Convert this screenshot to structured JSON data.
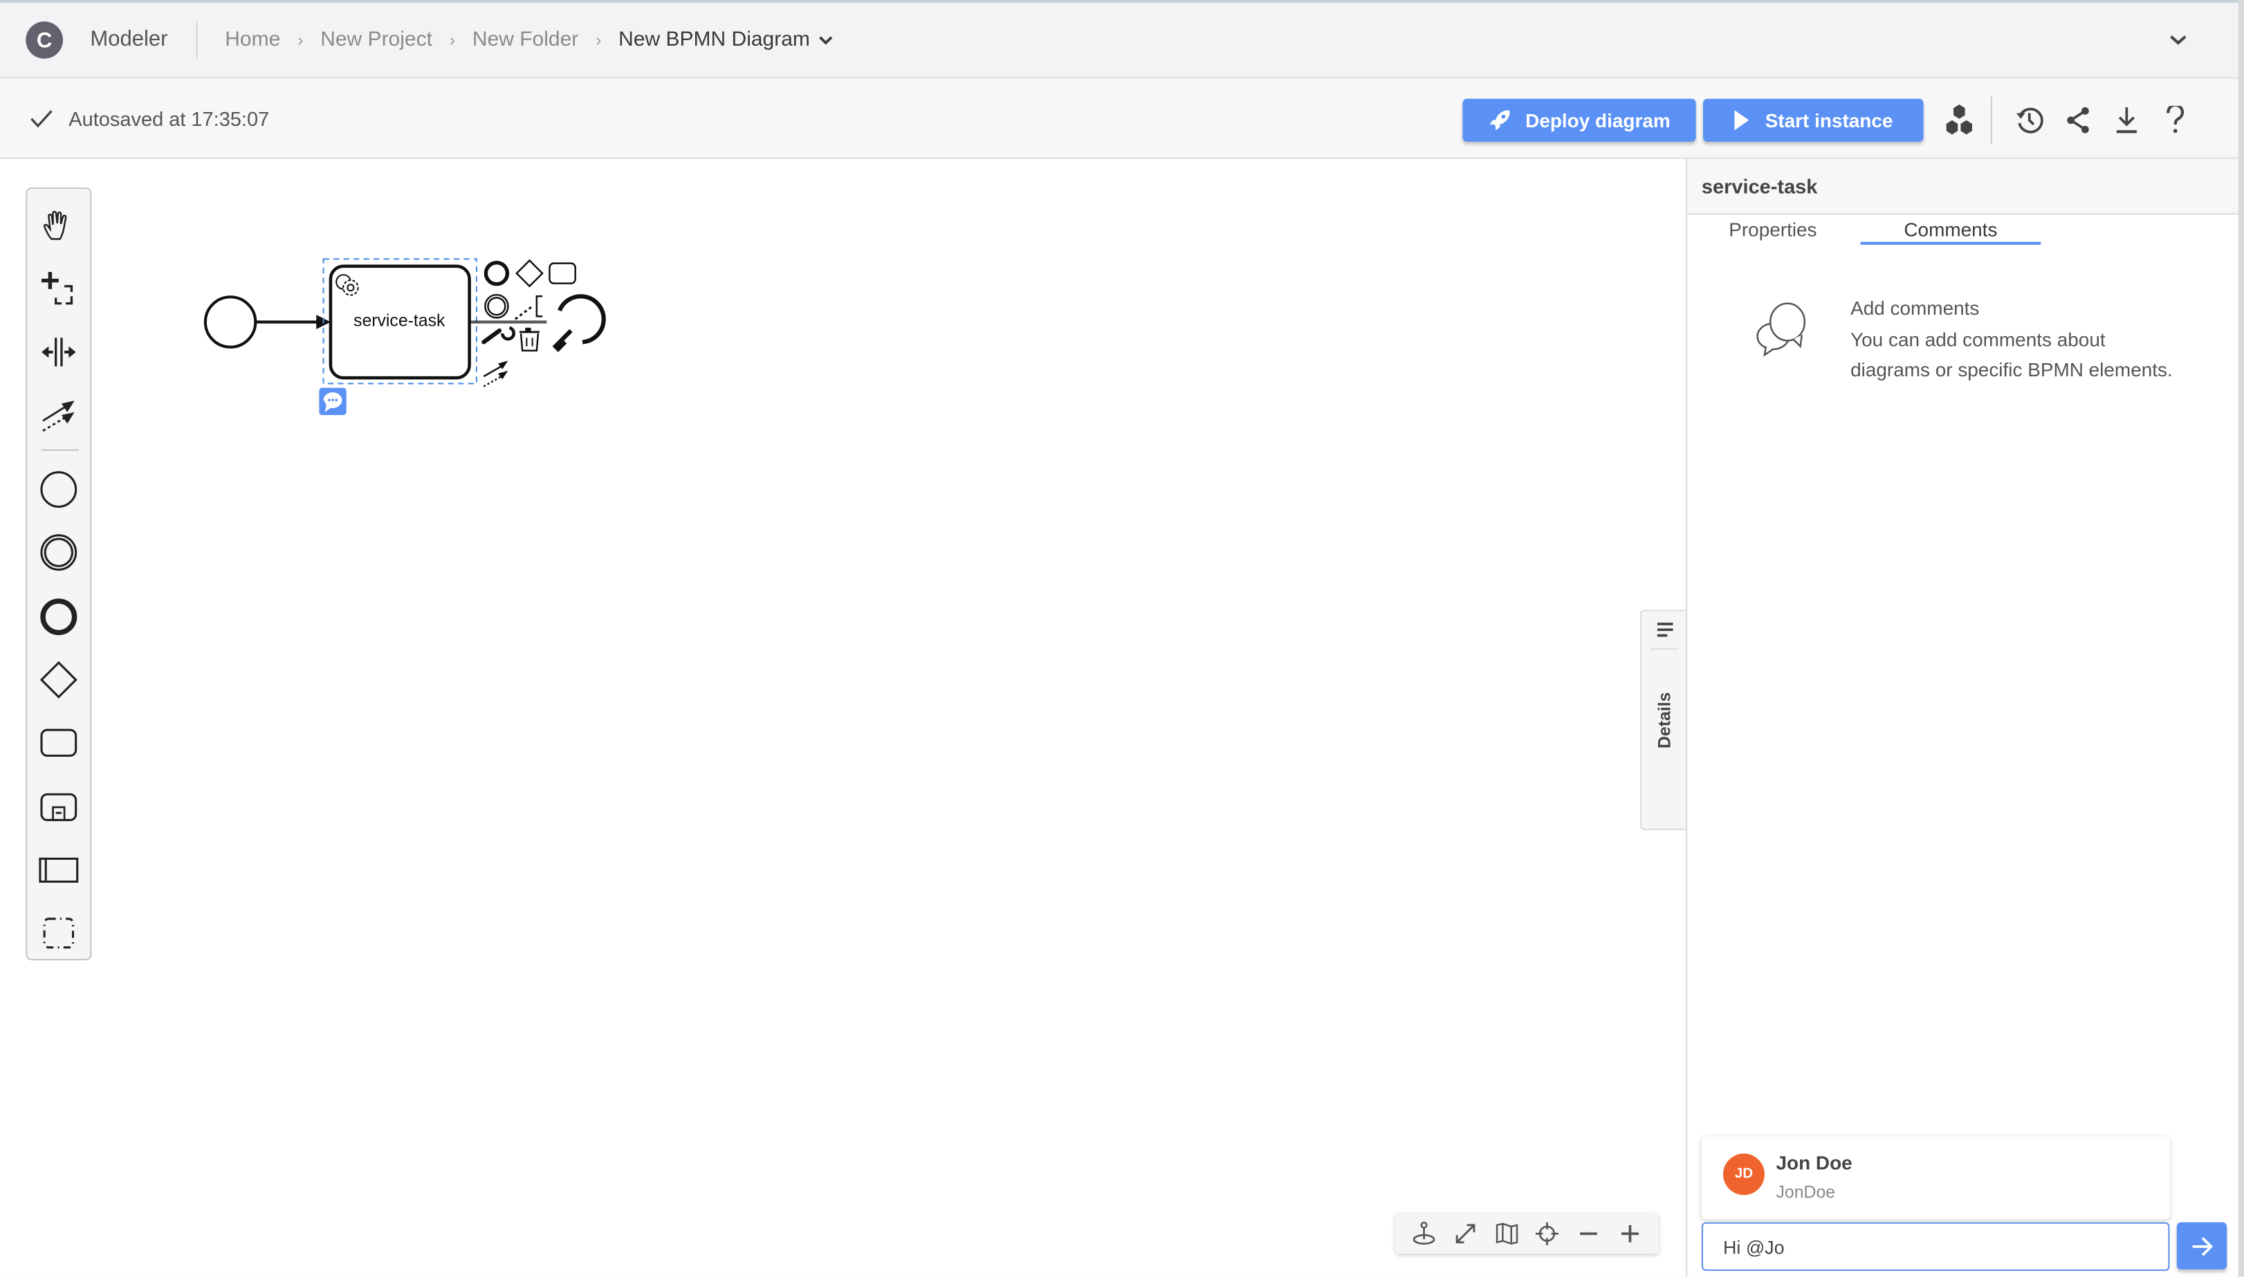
{
  "topbar": {
    "logo_letter": "C",
    "app_name": "Modeler",
    "breadcrumbs": [
      "Home",
      "New Project",
      "New Folder"
    ],
    "current_diagram": "New BPMN Diagram",
    "breadcrumb_separator": "›"
  },
  "subbar": {
    "status_icon": "check-icon",
    "autosave_text": "Autosaved at 17:35:07",
    "deploy_label": "Deploy diagram",
    "start_label": "Start instance",
    "icons": [
      "cluster-icon",
      "history-icon",
      "share-icon",
      "download-icon",
      "help-icon"
    ]
  },
  "palette": {
    "tools": [
      "hand-tool",
      "lasso-tool",
      "space-tool",
      "global-connect-tool",
      "start-event",
      "intermediate-event",
      "end-event",
      "gateway",
      "task",
      "subprocess",
      "pool",
      "group"
    ]
  },
  "diagram": {
    "task_label": "service-task",
    "context_pad": [
      "end-event",
      "gateway",
      "task",
      "intermediate-event",
      "text-annotation",
      "loop",
      "wrench",
      "delete",
      "color",
      "connect"
    ]
  },
  "side_tab": {
    "label": "Details"
  },
  "zoom_controls": [
    "drilldown-icon",
    "fit-icon",
    "minimap-icon",
    "reset-icon",
    "zoom-out-icon",
    "zoom-in-icon"
  ],
  "panel": {
    "title": "service-task",
    "tabs": [
      {
        "label": "Properties",
        "active": false
      },
      {
        "label": "Comments",
        "active": true
      }
    ],
    "empty_title": "Add comments",
    "empty_line1": "You can add comments about",
    "empty_line2": "diagrams or specific BPMN elements.",
    "mention": {
      "initials": "JD",
      "name": "Jon Doe",
      "username": "JonDoe"
    },
    "comment_value": "Hi @Jo",
    "send_icon": "→"
  },
  "colors": {
    "accent": "#5b91f5",
    "avatar": "#ee632e",
    "selection": "#4a90e2"
  }
}
